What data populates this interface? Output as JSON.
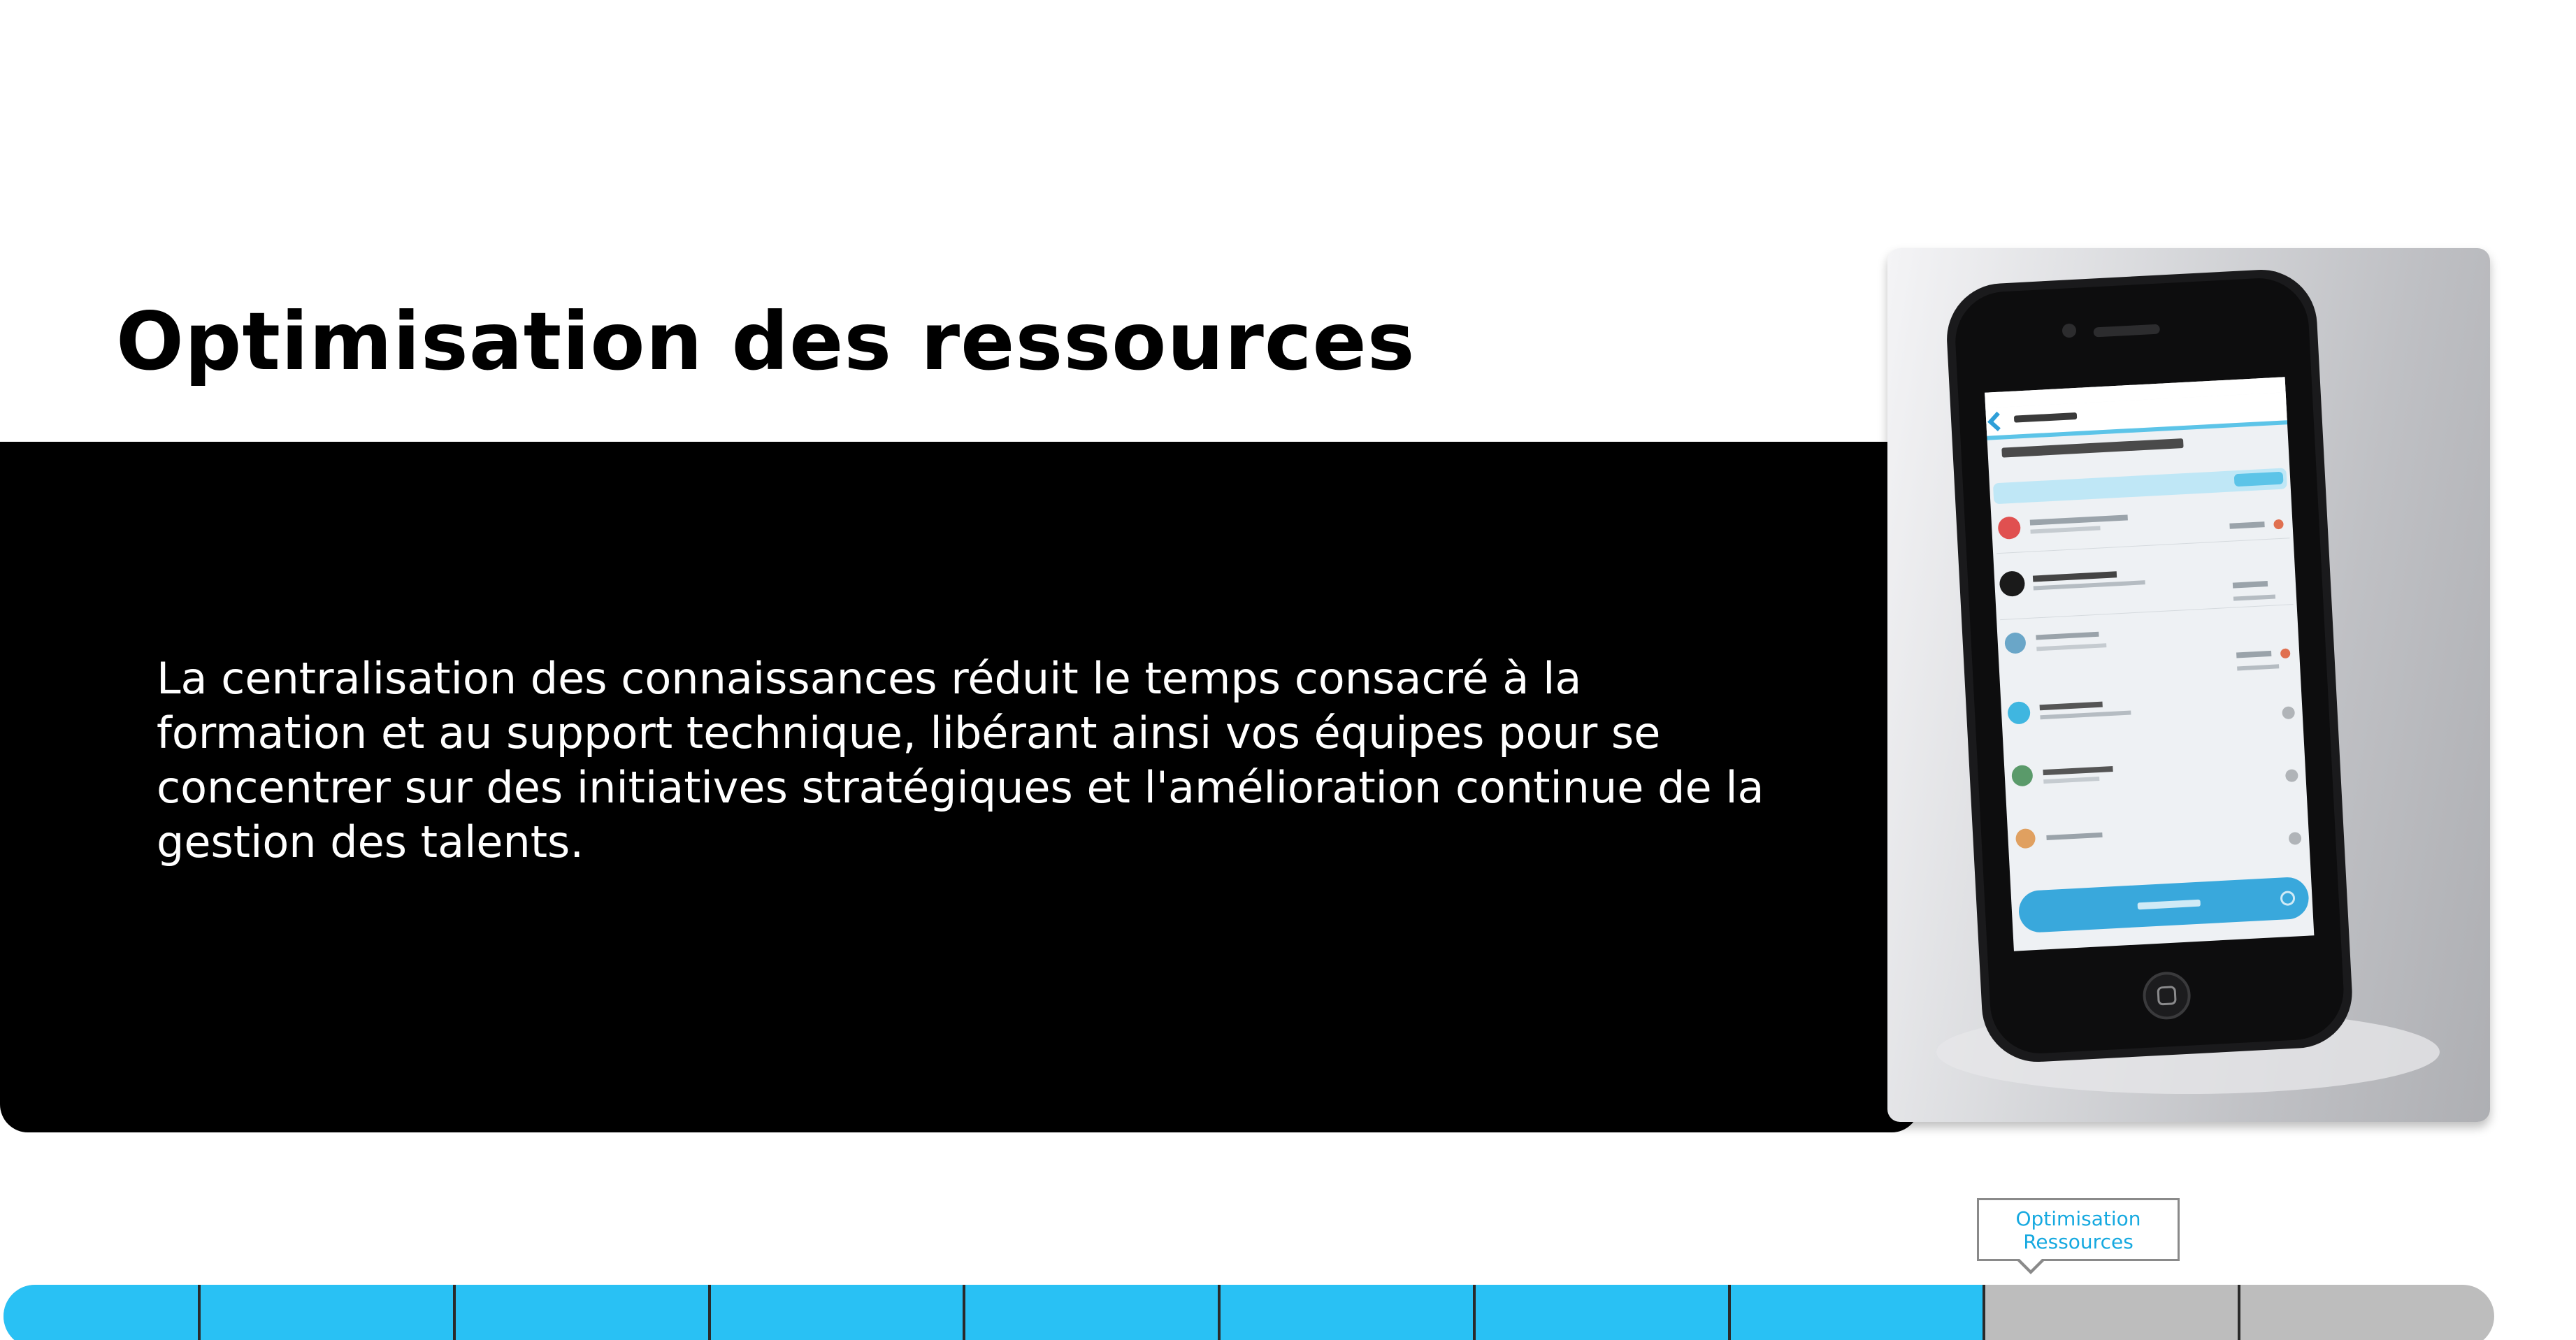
{
  "slide": {
    "title": "Optimisation des ressources",
    "body": "La centralisation des connaissances réduit le temps consacré à la formation et au support technique, libérant ainsi vos équipes pour se concentrer sur des initiatives stratégiques et l'amélioration continue de la gestion des talents."
  },
  "image": {
    "subject": "smartphone displaying a list-based mobile app",
    "icon": "smartphone-icon"
  },
  "progress": {
    "total_steps": 10,
    "completed_steps": 8,
    "current_label": "Optimisation Ressources",
    "fill_color": "#29c1f4",
    "track_color": "#bdbdbd",
    "label_color": "#16a9e0"
  }
}
